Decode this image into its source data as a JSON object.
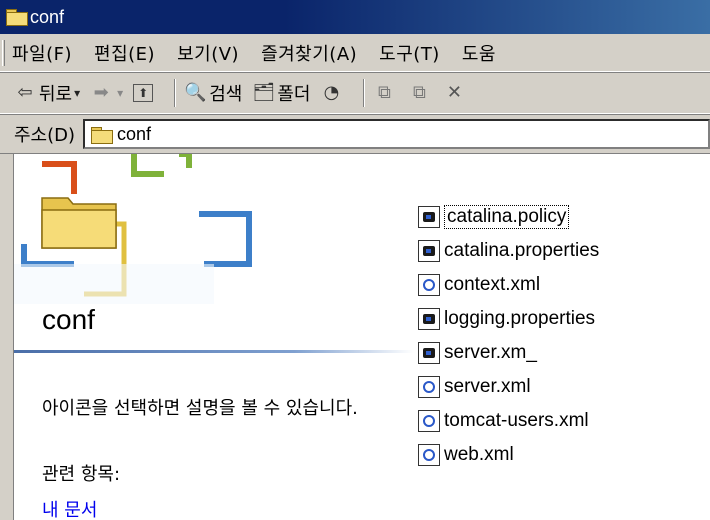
{
  "window": {
    "title": "conf"
  },
  "menu": {
    "items": [
      "파일(F)",
      "편집(E)",
      "보기(V)",
      "즐겨찾기(A)",
      "도구(T)",
      "도움"
    ]
  },
  "toolbar": {
    "back_label": "뒤로",
    "search_label": "검색",
    "folders_label": "폴더"
  },
  "address": {
    "label": "주소(D)",
    "value": "conf"
  },
  "panel": {
    "title": "conf",
    "description": "아이콘을 선택하면 설명을 볼 수 있습니다.",
    "related_label": "관련 항목:",
    "link_mydocs": "내 문서"
  },
  "files": [
    {
      "name": "catalina.policy",
      "icon": "config-file-icon",
      "selected": true
    },
    {
      "name": "catalina.properties",
      "icon": "config-file-icon"
    },
    {
      "name": "context.xml",
      "icon": "xml-file-icon"
    },
    {
      "name": "logging.properties",
      "icon": "config-file-icon"
    },
    {
      "name": "server.xm_",
      "icon": "config-file-icon"
    },
    {
      "name": "server.xml",
      "icon": "xml-file-icon"
    },
    {
      "name": "tomcat-users.xml",
      "icon": "xml-file-icon"
    },
    {
      "name": "web.xml",
      "icon": "xml-file-icon"
    }
  ],
  "colors": {
    "titlebar": "#0a246a",
    "chrome": "#d4d0c8",
    "link": "#0000ee"
  }
}
